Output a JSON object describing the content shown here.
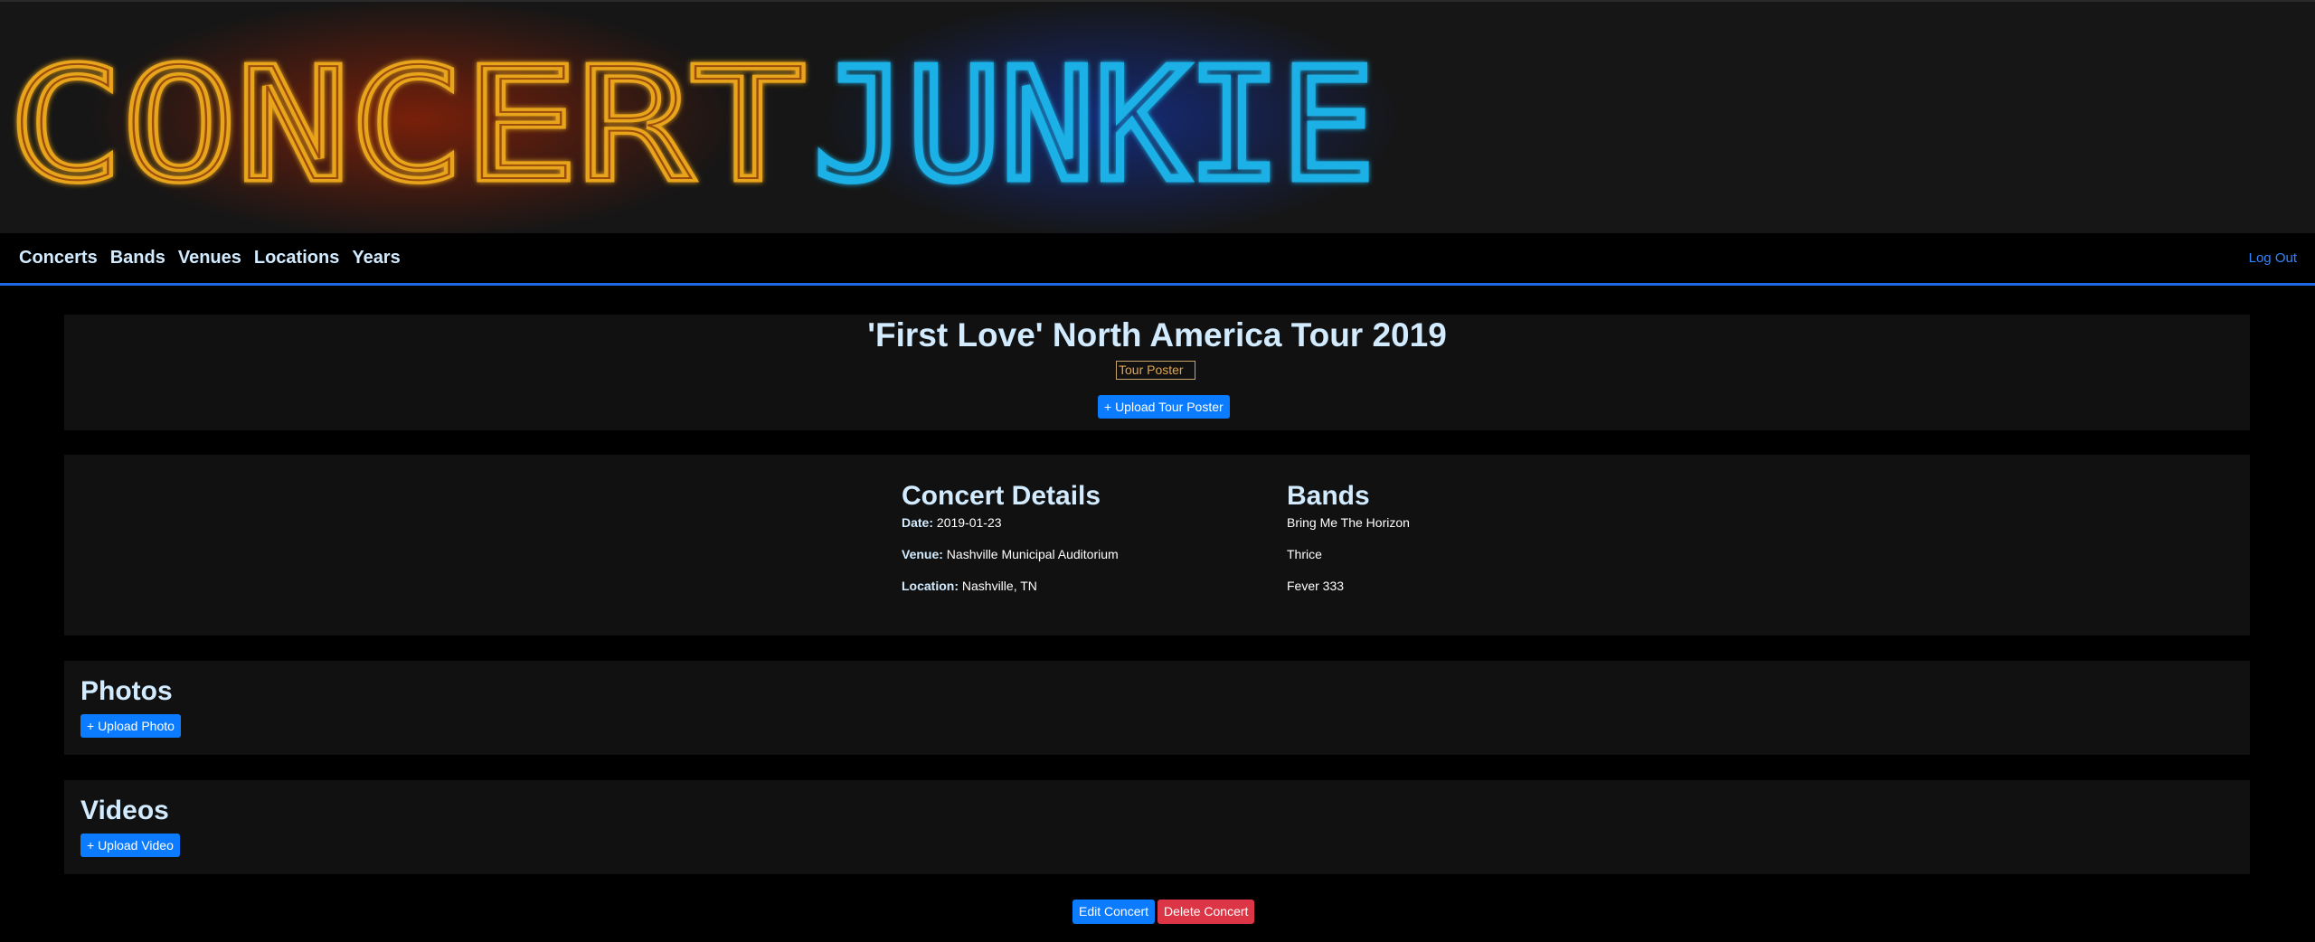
{
  "logo": {
    "part1": "CONCERT",
    "part2": "JUNKIE",
    "color1": "#e8a51c",
    "color2": "#1fb1e6"
  },
  "nav": {
    "links": [
      "Concerts",
      "Bands",
      "Venues",
      "Locations",
      "Years"
    ],
    "logout": "Log Out",
    "accent": "#1e6ae6"
  },
  "tour": {
    "title": "'First Love' North America Tour 2019",
    "poster_alt": "Tour Poster",
    "upload_poster": "+ Upload Tour Poster"
  },
  "details": {
    "heading": "Concert Details",
    "date_label": "Date:",
    "date": "2019-01-23",
    "venue_label": "Venue:",
    "venue": "Nashville Municipal Auditorium",
    "location_label": "Location:",
    "location": "Nashville, TN"
  },
  "bands": {
    "heading": "Bands",
    "items": [
      "Bring Me The Horizon",
      "Thrice",
      "Fever 333"
    ]
  },
  "photos": {
    "heading": "Photos",
    "upload": "+ Upload Photo"
  },
  "videos": {
    "heading": "Videos",
    "upload": "+ Upload Video"
  },
  "actions": {
    "edit": "Edit Concert",
    "delete": "Delete Concert"
  }
}
